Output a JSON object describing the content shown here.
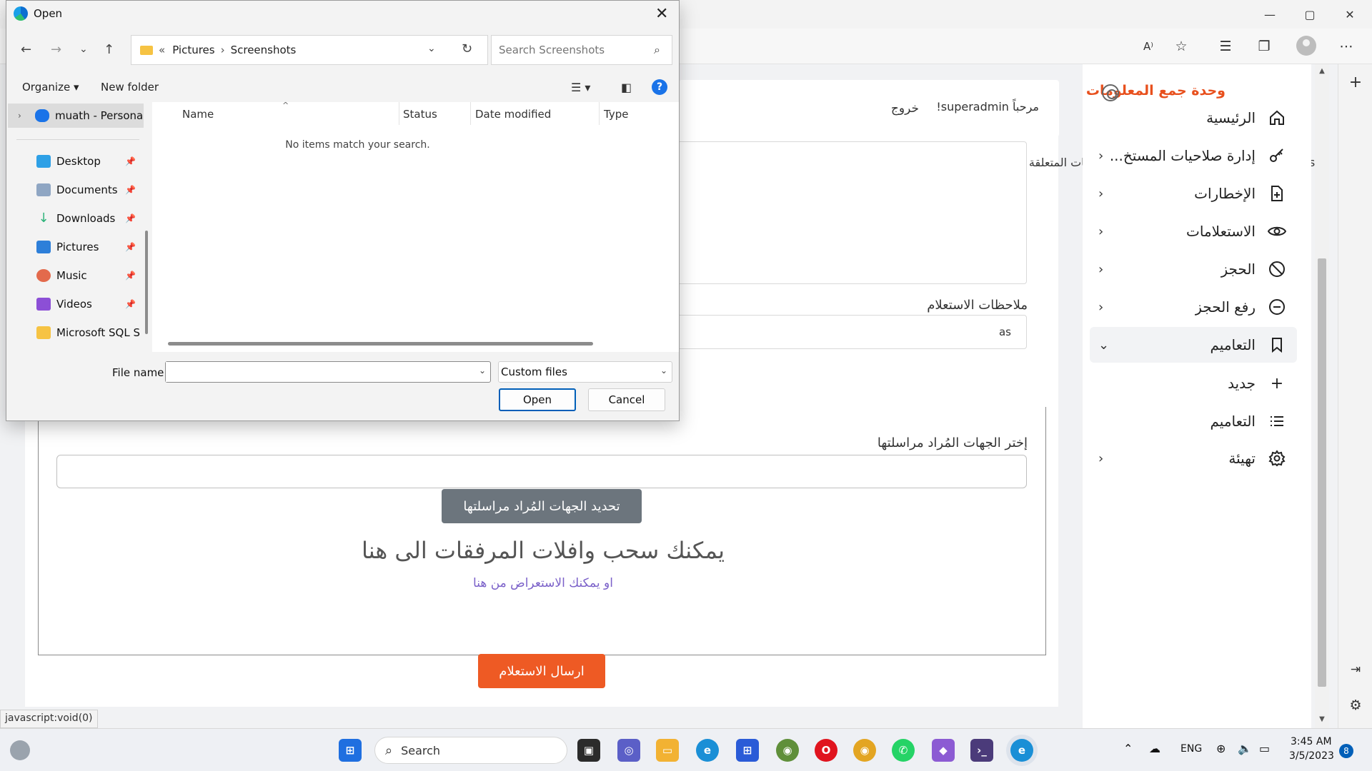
{
  "browser": {
    "window_controls": {
      "minimize": "—",
      "maximize": "▢",
      "close": "✕"
    },
    "toolbar_icons": [
      "read-aloud-icon",
      "favorite-add-icon",
      "favorites-icon",
      "collections-icon",
      "profile-icon",
      "more-icon"
    ]
  },
  "site": {
    "brand": "وحدة جمع المعلومات",
    "greeting": "مرحباً superadmin!",
    "logout": "خروج",
    "nav": [
      {
        "label": "الرئيسية",
        "icon": "home-icon",
        "chevron": false
      },
      {
        "label": "إدارة صلاحيات المستخ...",
        "icon": "key-icon",
        "chevron": true
      },
      {
        "label": "الإخطارات",
        "icon": "file-plus-icon",
        "chevron": true
      },
      {
        "label": "الاستعلامات",
        "icon": "eye-icon",
        "chevron": true
      },
      {
        "label": "الحجز",
        "icon": "block-icon",
        "chevron": true
      },
      {
        "label": "رفع الحجز",
        "icon": "minus-circle-icon",
        "chevron": true
      },
      {
        "label": "التعاميم",
        "icon": "bookmark-icon",
        "chevron": true,
        "active": true
      }
    ],
    "subnav": [
      {
        "label": "جديد",
        "icon": "plus-icon"
      },
      {
        "label": "التعاميم",
        "icon": "list-icon"
      }
    ],
    "settings": {
      "label": "تهيئة",
      "icon": "gear-icon"
    }
  },
  "form": {
    "body_text": "saبالاشارة الى الموضوع اعلاه يرجى موافاتنا بالبيانات المتعلقة",
    "notes_label": "ملاحظات الاستعلام",
    "notes_value": "as",
    "recipients_label": "إختر الجهات المُراد مراسلتها",
    "recipients_button": "تحديد الجهات المُراد مراسلتها",
    "drop_title": "يمكنك سحب وافلات المرفقات الى هنا",
    "drop_subtitle": "او يمكنك الاستعراض من هنا",
    "send_button": "ارسال الاستعلام"
  },
  "status_tip": "javascript:void(0)",
  "dialog": {
    "title": "Open",
    "breadcrumb": [
      "Pictures",
      "Screenshots"
    ],
    "breadcrumb_prefix": "«",
    "search_placeholder": "Search Screenshots",
    "organize": "Organize",
    "new_folder": "New folder",
    "help": "?",
    "tree": [
      {
        "label": "muath - Persona",
        "pinned": false,
        "color": "#1a73e8"
      },
      {
        "label": "Desktop",
        "pinned": true,
        "color": "#2ea0e6"
      },
      {
        "label": "Documents",
        "pinned": true,
        "color": "#8fa6c3"
      },
      {
        "label": "Downloads",
        "pinned": true,
        "color": "#2db37a"
      },
      {
        "label": "Pictures",
        "pinned": true,
        "color": "#2d7fd9"
      },
      {
        "label": "Music",
        "pinned": true,
        "color": "#e36a4c"
      },
      {
        "label": "Videos",
        "pinned": true,
        "color": "#8c4fd6"
      },
      {
        "label": "Microsoft SQL S",
        "pinned": false,
        "color": "#f6c343"
      }
    ],
    "columns": [
      "Name",
      "Status",
      "Date modified",
      "Type"
    ],
    "empty_message": "No items match your search.",
    "file_name_label": "File name:",
    "file_name_value": "",
    "file_type": "Custom files",
    "open_button": "Open",
    "cancel_button": "Cancel"
  },
  "taskbar": {
    "search_label": "Search",
    "language": "ENG",
    "time": "3:45 AM",
    "date": "3/5/2023",
    "notification_count": "8",
    "apps": [
      {
        "name": "start-icon",
        "color": "#1f6fe0",
        "glyph": ""
      },
      {
        "name": "task-view-icon",
        "color": "#2b2b2b",
        "glyph": ""
      },
      {
        "name": "teams-chat-icon",
        "color": "#5b5fc7",
        "glyph": ""
      },
      {
        "name": "file-explorer-icon",
        "color": "#f2b233",
        "glyph": ""
      },
      {
        "name": "edge-icon",
        "color": "#1a8fd6",
        "glyph": ""
      },
      {
        "name": "store-icon",
        "color": "#2a5bd7",
        "glyph": ""
      },
      {
        "name": "chrome-dev-icon",
        "color": "#5f8f3a",
        "glyph": ""
      },
      {
        "name": "opera-icon",
        "color": "#e0141e",
        "glyph": "O"
      },
      {
        "name": "chrome-icon",
        "color": "#e3a522",
        "glyph": ""
      },
      {
        "name": "whatsapp-icon",
        "color": "#25d366",
        "glyph": ""
      },
      {
        "name": "visual-studio-icon",
        "color": "#8c5bd3",
        "glyph": ""
      },
      {
        "name": "terminal-icon",
        "color": "#4b3b7a",
        "glyph": ""
      },
      {
        "name": "edge-active-icon",
        "color": "#1a8fd6",
        "glyph": ""
      }
    ]
  }
}
